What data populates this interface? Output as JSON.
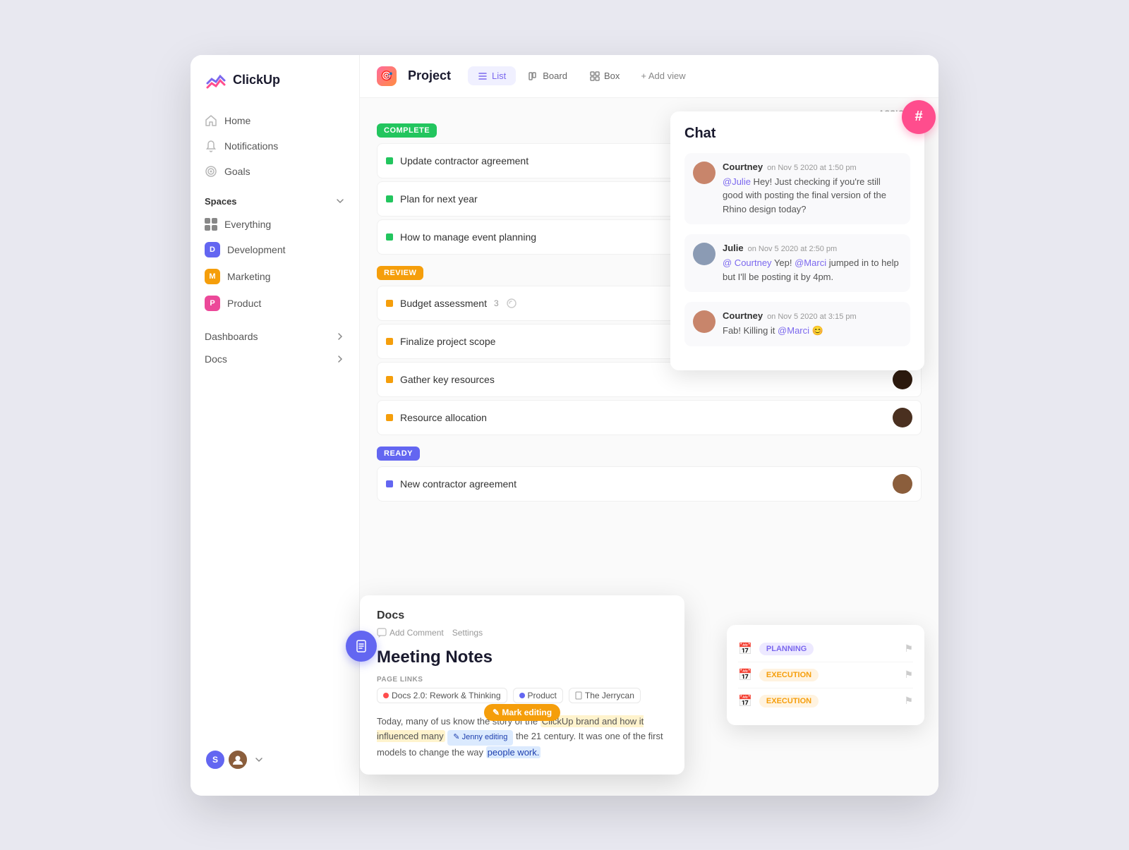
{
  "app": {
    "logo_text": "ClickUp"
  },
  "sidebar": {
    "nav_items": [
      {
        "label": "Home",
        "icon": "home"
      },
      {
        "label": "Notifications",
        "icon": "bell"
      },
      {
        "label": "Goals",
        "icon": "target"
      }
    ],
    "spaces_label": "Spaces",
    "spaces": [
      {
        "label": "Everything",
        "icon": "grid"
      },
      {
        "label": "Development",
        "letter": "D",
        "color": "#6366f1"
      },
      {
        "label": "Marketing",
        "letter": "M",
        "color": "#f59e0b"
      },
      {
        "label": "Product",
        "letter": "P",
        "color": "#ec4899"
      }
    ],
    "dashboards_label": "Dashboards",
    "docs_label": "Docs"
  },
  "header": {
    "project_label": "Project",
    "tabs": [
      {
        "label": "List",
        "active": true
      },
      {
        "label": "Board",
        "active": false
      },
      {
        "label": "Box",
        "active": false
      }
    ],
    "add_view_label": "+ Add view",
    "assignee_col": "ASSIGNEE"
  },
  "task_groups": [
    {
      "status": "COMPLETE",
      "color": "#22c55e",
      "tasks": [
        {
          "name": "Update contractor agreement",
          "avatar_color": "#c8956b"
        },
        {
          "name": "Plan for next year",
          "avatar_color": "#b8d4e8"
        },
        {
          "name": "How to manage event planning",
          "avatar_color": "#d4c8e0"
        }
      ]
    },
    {
      "status": "REVIEW",
      "color": "#f59e0b",
      "tasks": [
        {
          "name": "Budget assessment",
          "count": "3",
          "avatar_color": "#5e4b3e"
        },
        {
          "name": "Finalize project scope",
          "avatar_color": "#6b7b6b"
        },
        {
          "name": "Gather key resources",
          "avatar_color": "#2d1a0e"
        },
        {
          "name": "Resource allocation",
          "avatar_color": "#4a2a1a"
        }
      ]
    },
    {
      "status": "READY",
      "color": "#6366f1",
      "tasks": [
        {
          "name": "New contractor agreement",
          "avatar_color": "#8b5e3c"
        }
      ]
    }
  ],
  "chat": {
    "title": "Chat",
    "hash_symbol": "#",
    "messages": [
      {
        "name": "Courtney",
        "time": "on Nov 5 2020 at 1:50 pm",
        "text": "@Julie Hey! Just checking if you're still good with posting the final version of the Rhino design today?",
        "mention": "@Julie",
        "avatar_color": "#c8856b"
      },
      {
        "name": "Julie",
        "time": "on Nov 5 2020 at 2:50 pm",
        "text": "@ Courtney Yep! @Marci jumped in to help but I'll be posting it by 4pm.",
        "mention": "@Courtney",
        "mention2": "@Marci",
        "avatar_color": "#8b9bb4"
      },
      {
        "name": "Courtney",
        "time": "on Nov 5 2020 at 3:15 pm",
        "text": "Fab! Killing it @Marci 😊",
        "mention": "@Marci",
        "avatar_color": "#c8856b"
      }
    ]
  },
  "schedule": {
    "rows": [
      {
        "tag": "PLANNING",
        "tag_class": "tag-planning"
      },
      {
        "tag": "EXECUTION",
        "tag_class": "tag-execution"
      },
      {
        "tag": "EXECUTION",
        "tag_class": "tag-execution"
      }
    ]
  },
  "docs": {
    "section_title": "Docs",
    "add_comment_label": "Add Comment",
    "settings_label": "Settings",
    "meeting_title": "Meeting Notes",
    "page_links_label": "PAGE LINKS",
    "page_links": [
      {
        "label": "Docs 2.0: Rework & Thinking",
        "dot_color": "#ff4d4d"
      },
      {
        "label": "Product",
        "dot_color": "#6366f1"
      },
      {
        "label": "The Jerrycan",
        "dot_color": "#999"
      }
    ],
    "mark_editing_label": "✎ Mark editing",
    "jenny_editing_label": "✎ Jenny editing",
    "body_text_1": "Today, many of us know the story of the ",
    "body_highlight": "ClickUp brand and how it influenced many",
    "body_text_2": " the 21 century. It was one of the first models  to change the way people work."
  }
}
